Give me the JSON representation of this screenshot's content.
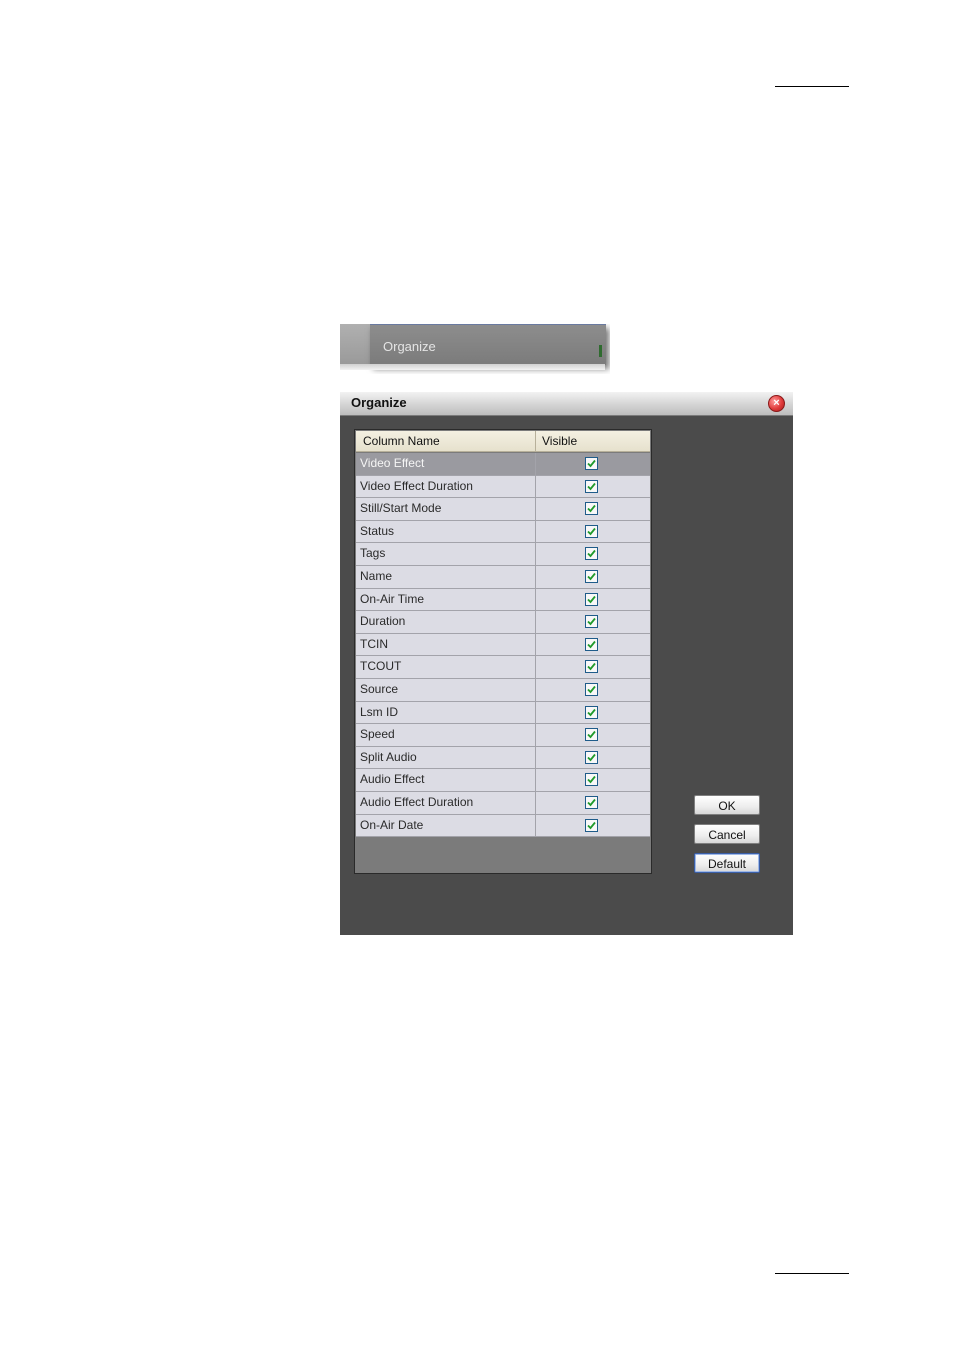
{
  "menu": {
    "item_label": "Organize"
  },
  "dialog": {
    "title": "Organize",
    "close_glyph": "×",
    "columns": {
      "name_header": "Column Name",
      "visible_header": "Visible"
    },
    "rows": [
      {
        "name": "Video Effect",
        "visible": true,
        "selected": true
      },
      {
        "name": "Video Effect Duration",
        "visible": true
      },
      {
        "name": "Still/Start Mode",
        "visible": true
      },
      {
        "name": "Status",
        "visible": true
      },
      {
        "name": "Tags",
        "visible": true
      },
      {
        "name": "Name",
        "visible": true
      },
      {
        "name": "On-Air Time",
        "visible": true
      },
      {
        "name": "Duration",
        "visible": true
      },
      {
        "name": "TCIN",
        "visible": true
      },
      {
        "name": "TCOUT",
        "visible": true
      },
      {
        "name": "Source",
        "visible": true
      },
      {
        "name": "Lsm ID",
        "visible": true
      },
      {
        "name": "Speed",
        "visible": true
      },
      {
        "name": "Split Audio",
        "visible": true
      },
      {
        "name": "Audio Effect",
        "visible": true
      },
      {
        "name": "Audio Effect Duration",
        "visible": true
      },
      {
        "name": "On-Air Date",
        "visible": true
      }
    ],
    "buttons": {
      "ok": "OK",
      "cancel": "Cancel",
      "default": "Default"
    }
  },
  "colors": {
    "dialog_bg": "#4b4b4b",
    "row_bg": "#dcdce4",
    "selected_row_bg": "#9a9aa0",
    "check_green": "#1f9a2a",
    "default_button_border": "#3a5fa8"
  },
  "icons": {
    "close": "close-icon",
    "check": "checkmark-icon"
  }
}
